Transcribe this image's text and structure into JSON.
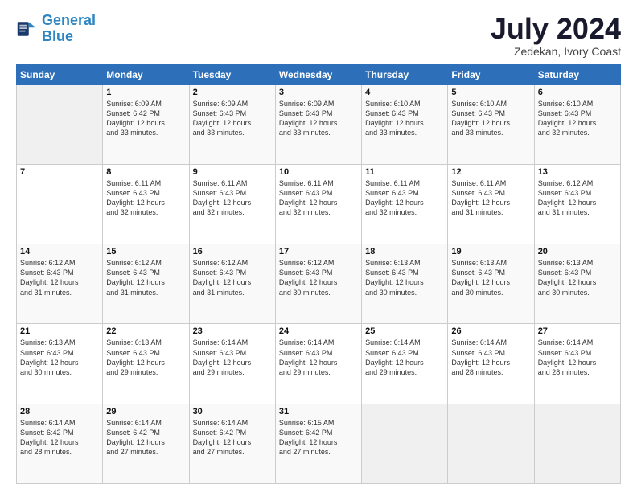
{
  "header": {
    "logo_line1": "General",
    "logo_line2": "Blue",
    "month": "July 2024",
    "location": "Zedekan, Ivory Coast"
  },
  "weekdays": [
    "Sunday",
    "Monday",
    "Tuesday",
    "Wednesday",
    "Thursday",
    "Friday",
    "Saturday"
  ],
  "weeks": [
    [
      {
        "day": "",
        "info": ""
      },
      {
        "day": "1",
        "info": "Sunrise: 6:09 AM\nSunset: 6:42 PM\nDaylight: 12 hours\nand 33 minutes."
      },
      {
        "day": "2",
        "info": "Sunrise: 6:09 AM\nSunset: 6:43 PM\nDaylight: 12 hours\nand 33 minutes."
      },
      {
        "day": "3",
        "info": "Sunrise: 6:09 AM\nSunset: 6:43 PM\nDaylight: 12 hours\nand 33 minutes."
      },
      {
        "day": "4",
        "info": "Sunrise: 6:10 AM\nSunset: 6:43 PM\nDaylight: 12 hours\nand 33 minutes."
      },
      {
        "day": "5",
        "info": "Sunrise: 6:10 AM\nSunset: 6:43 PM\nDaylight: 12 hours\nand 33 minutes."
      },
      {
        "day": "6",
        "info": "Sunrise: 6:10 AM\nSunset: 6:43 PM\nDaylight: 12 hours\nand 32 minutes."
      }
    ],
    [
      {
        "day": "7",
        "info": ""
      },
      {
        "day": "8",
        "info": "Sunrise: 6:11 AM\nSunset: 6:43 PM\nDaylight: 12 hours\nand 32 minutes."
      },
      {
        "day": "9",
        "info": "Sunrise: 6:11 AM\nSunset: 6:43 PM\nDaylight: 12 hours\nand 32 minutes."
      },
      {
        "day": "10",
        "info": "Sunrise: 6:11 AM\nSunset: 6:43 PM\nDaylight: 12 hours\nand 32 minutes."
      },
      {
        "day": "11",
        "info": "Sunrise: 6:11 AM\nSunset: 6:43 PM\nDaylight: 12 hours\nand 32 minutes."
      },
      {
        "day": "12",
        "info": "Sunrise: 6:11 AM\nSunset: 6:43 PM\nDaylight: 12 hours\nand 31 minutes."
      },
      {
        "day": "13",
        "info": "Sunrise: 6:12 AM\nSunset: 6:43 PM\nDaylight: 12 hours\nand 31 minutes."
      }
    ],
    [
      {
        "day": "14",
        "info": "Sunrise: 6:12 AM\nSunset: 6:43 PM\nDaylight: 12 hours\nand 31 minutes."
      },
      {
        "day": "15",
        "info": "Sunrise: 6:12 AM\nSunset: 6:43 PM\nDaylight: 12 hours\nand 31 minutes."
      },
      {
        "day": "16",
        "info": "Sunrise: 6:12 AM\nSunset: 6:43 PM\nDaylight: 12 hours\nand 31 minutes."
      },
      {
        "day": "17",
        "info": "Sunrise: 6:12 AM\nSunset: 6:43 PM\nDaylight: 12 hours\nand 30 minutes."
      },
      {
        "day": "18",
        "info": "Sunrise: 6:13 AM\nSunset: 6:43 PM\nDaylight: 12 hours\nand 30 minutes."
      },
      {
        "day": "19",
        "info": "Sunrise: 6:13 AM\nSunset: 6:43 PM\nDaylight: 12 hours\nand 30 minutes."
      },
      {
        "day": "20",
        "info": "Sunrise: 6:13 AM\nSunset: 6:43 PM\nDaylight: 12 hours\nand 30 minutes."
      }
    ],
    [
      {
        "day": "21",
        "info": "Sunrise: 6:13 AM\nSunset: 6:43 PM\nDaylight: 12 hours\nand 30 minutes."
      },
      {
        "day": "22",
        "info": "Sunrise: 6:13 AM\nSunset: 6:43 PM\nDaylight: 12 hours\nand 29 minutes."
      },
      {
        "day": "23",
        "info": "Sunrise: 6:14 AM\nSunset: 6:43 PM\nDaylight: 12 hours\nand 29 minutes."
      },
      {
        "day": "24",
        "info": "Sunrise: 6:14 AM\nSunset: 6:43 PM\nDaylight: 12 hours\nand 29 minutes."
      },
      {
        "day": "25",
        "info": "Sunrise: 6:14 AM\nSunset: 6:43 PM\nDaylight: 12 hours\nand 29 minutes."
      },
      {
        "day": "26",
        "info": "Sunrise: 6:14 AM\nSunset: 6:43 PM\nDaylight: 12 hours\nand 28 minutes."
      },
      {
        "day": "27",
        "info": "Sunrise: 6:14 AM\nSunset: 6:43 PM\nDaylight: 12 hours\nand 28 minutes."
      }
    ],
    [
      {
        "day": "28",
        "info": "Sunrise: 6:14 AM\nSunset: 6:42 PM\nDaylight: 12 hours\nand 28 minutes."
      },
      {
        "day": "29",
        "info": "Sunrise: 6:14 AM\nSunset: 6:42 PM\nDaylight: 12 hours\nand 27 minutes."
      },
      {
        "day": "30",
        "info": "Sunrise: 6:14 AM\nSunset: 6:42 PM\nDaylight: 12 hours\nand 27 minutes."
      },
      {
        "day": "31",
        "info": "Sunrise: 6:15 AM\nSunset: 6:42 PM\nDaylight: 12 hours\nand 27 minutes."
      },
      {
        "day": "",
        "info": ""
      },
      {
        "day": "",
        "info": ""
      },
      {
        "day": "",
        "info": ""
      }
    ]
  ]
}
